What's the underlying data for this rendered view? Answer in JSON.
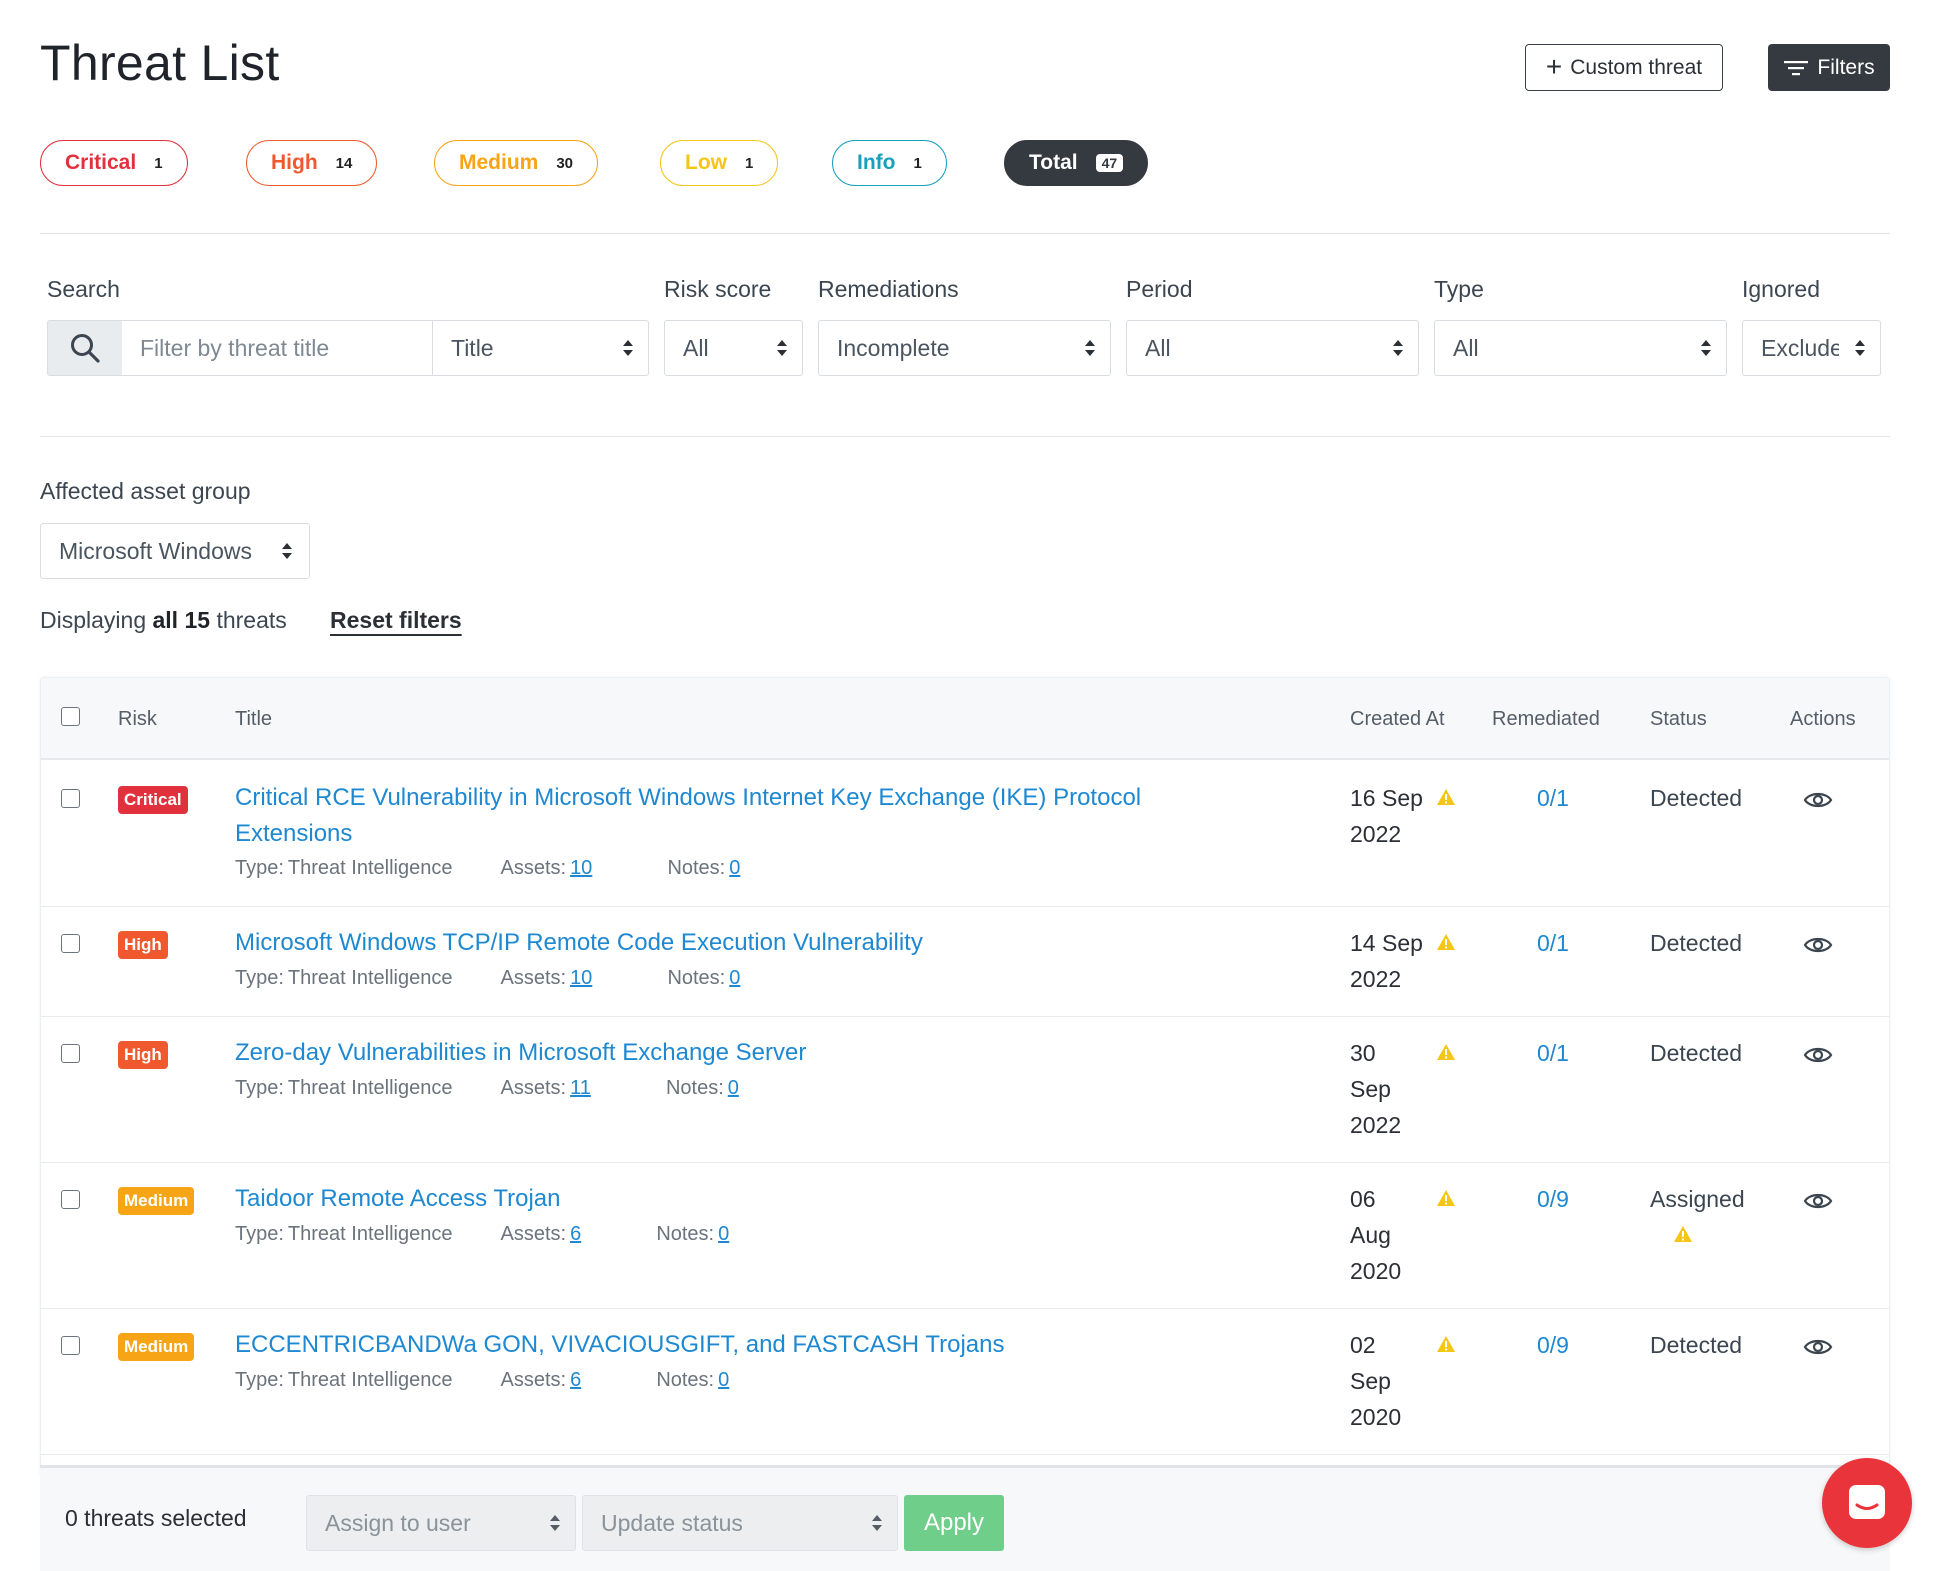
{
  "header": {
    "title": "Threat List",
    "custom_threat_label": "Custom threat",
    "filters_label": "Filters"
  },
  "risk_pills": [
    {
      "label": "Critical",
      "count": "1",
      "color": "#e0313c"
    },
    {
      "label": "High",
      "count": "14",
      "color": "#f0592e"
    },
    {
      "label": "Medium",
      "count": "30",
      "color": "#f7a416"
    },
    {
      "label": "Low",
      "count": "1",
      "color": "#f5c518"
    },
    {
      "label": "Info",
      "count": "1",
      "color": "#1a9fbd"
    },
    {
      "label": "Total",
      "count": "47",
      "color": "#353a40"
    }
  ],
  "filters": {
    "search_label": "Search",
    "search_placeholder": "Filter by threat title",
    "search_field": "Title",
    "risk_score_label": "Risk score",
    "risk_score_value": "All",
    "remediations_label": "Remediations",
    "remediations_value": "Incomplete",
    "period_label": "Period",
    "period_value": "All",
    "type_label": "Type",
    "type_value": "All",
    "ignored_label": "Ignored",
    "ignored_value": "Exclude"
  },
  "asset_group": {
    "label": "Affected asset group",
    "value": "Microsoft Windows"
  },
  "summary": {
    "prefix": "Displaying",
    "bold": "all 15",
    "suffix": "threats",
    "reset_label": "Reset filters"
  },
  "table": {
    "headers": {
      "risk": "Risk",
      "title": "Title",
      "created": "Created At",
      "remediated": "Remediated",
      "status": "Status",
      "actions": "Actions"
    },
    "meta_labels": {
      "type": "Type:",
      "assets": "Assets:",
      "notes": "Notes:"
    },
    "rows": [
      {
        "risk": "Critical",
        "risk_color": "#e0313c",
        "title_line1": "Critical RCE Vulnerability in Microsoft Windows Internet Key Exchange (IKE) Protocol",
        "title_line2": "Extensions",
        "type": "Threat Intelligence",
        "assets": "10",
        "notes": "0",
        "created_1": "16 Sep",
        "created_2": "2022",
        "created_3": "",
        "remediated": "0/1",
        "status": "Detected"
      },
      {
        "risk": "High",
        "risk_color": "#f0592e",
        "title_line1": "Microsoft Windows TCP/IP Remote Code Execution Vulnerability",
        "title_line2": "",
        "type": "Threat Intelligence",
        "assets": "10",
        "notes": "0",
        "created_1": "14 Sep",
        "created_2": "2022",
        "created_3": "",
        "remediated": "0/1",
        "status": "Detected"
      },
      {
        "risk": "High",
        "risk_color": "#f0592e",
        "title_line1": "Zero-day Vulnerabilities in Microsoft Exchange Server",
        "title_line2": "",
        "type": "Threat Intelligence",
        "assets": "11",
        "notes": "0",
        "created_1": "30",
        "created_2": "Sep",
        "created_3": "2022",
        "remediated": "0/1",
        "status": "Detected"
      },
      {
        "risk": "Medium",
        "risk_color": "#f7a416",
        "title_line1": "Taidoor Remote Access Trojan",
        "title_line2": "",
        "type": "Threat Intelligence",
        "assets": "6",
        "notes": "0",
        "created_1": "06",
        "created_2": "Aug",
        "created_3": "2020",
        "remediated": "0/9",
        "status": "Assigned"
      },
      {
        "risk": "Medium",
        "risk_color": "#f7a416",
        "title_line1": "ECCENTRICBANDWa GON, VIVACIOUSGIFT, and FASTCASH Trojans",
        "title_line2": "",
        "type": "Threat Intelligence",
        "assets": "6",
        "notes": "0",
        "created_1": "02",
        "created_2": "Sep",
        "created_3": "2020",
        "remediated": "0/9",
        "status": "Detected"
      }
    ]
  },
  "bulk_bar": {
    "selected_text": "0 threats selected",
    "assign_placeholder": "Assign to user",
    "status_placeholder": "Update status",
    "apply_label": "Apply"
  },
  "icons": {
    "search": "search-icon",
    "plus": "plus-icon",
    "filters": "filter-lines-icon",
    "sort": "sort-arrows-icon",
    "warning": "warning-triangle-icon",
    "view": "eye-icon",
    "chat": "chat-icon"
  },
  "colors": {
    "link": "#1e88d0",
    "warning": "#f5c518",
    "apply": "#6fcf8a",
    "chat": "#e8343a"
  }
}
